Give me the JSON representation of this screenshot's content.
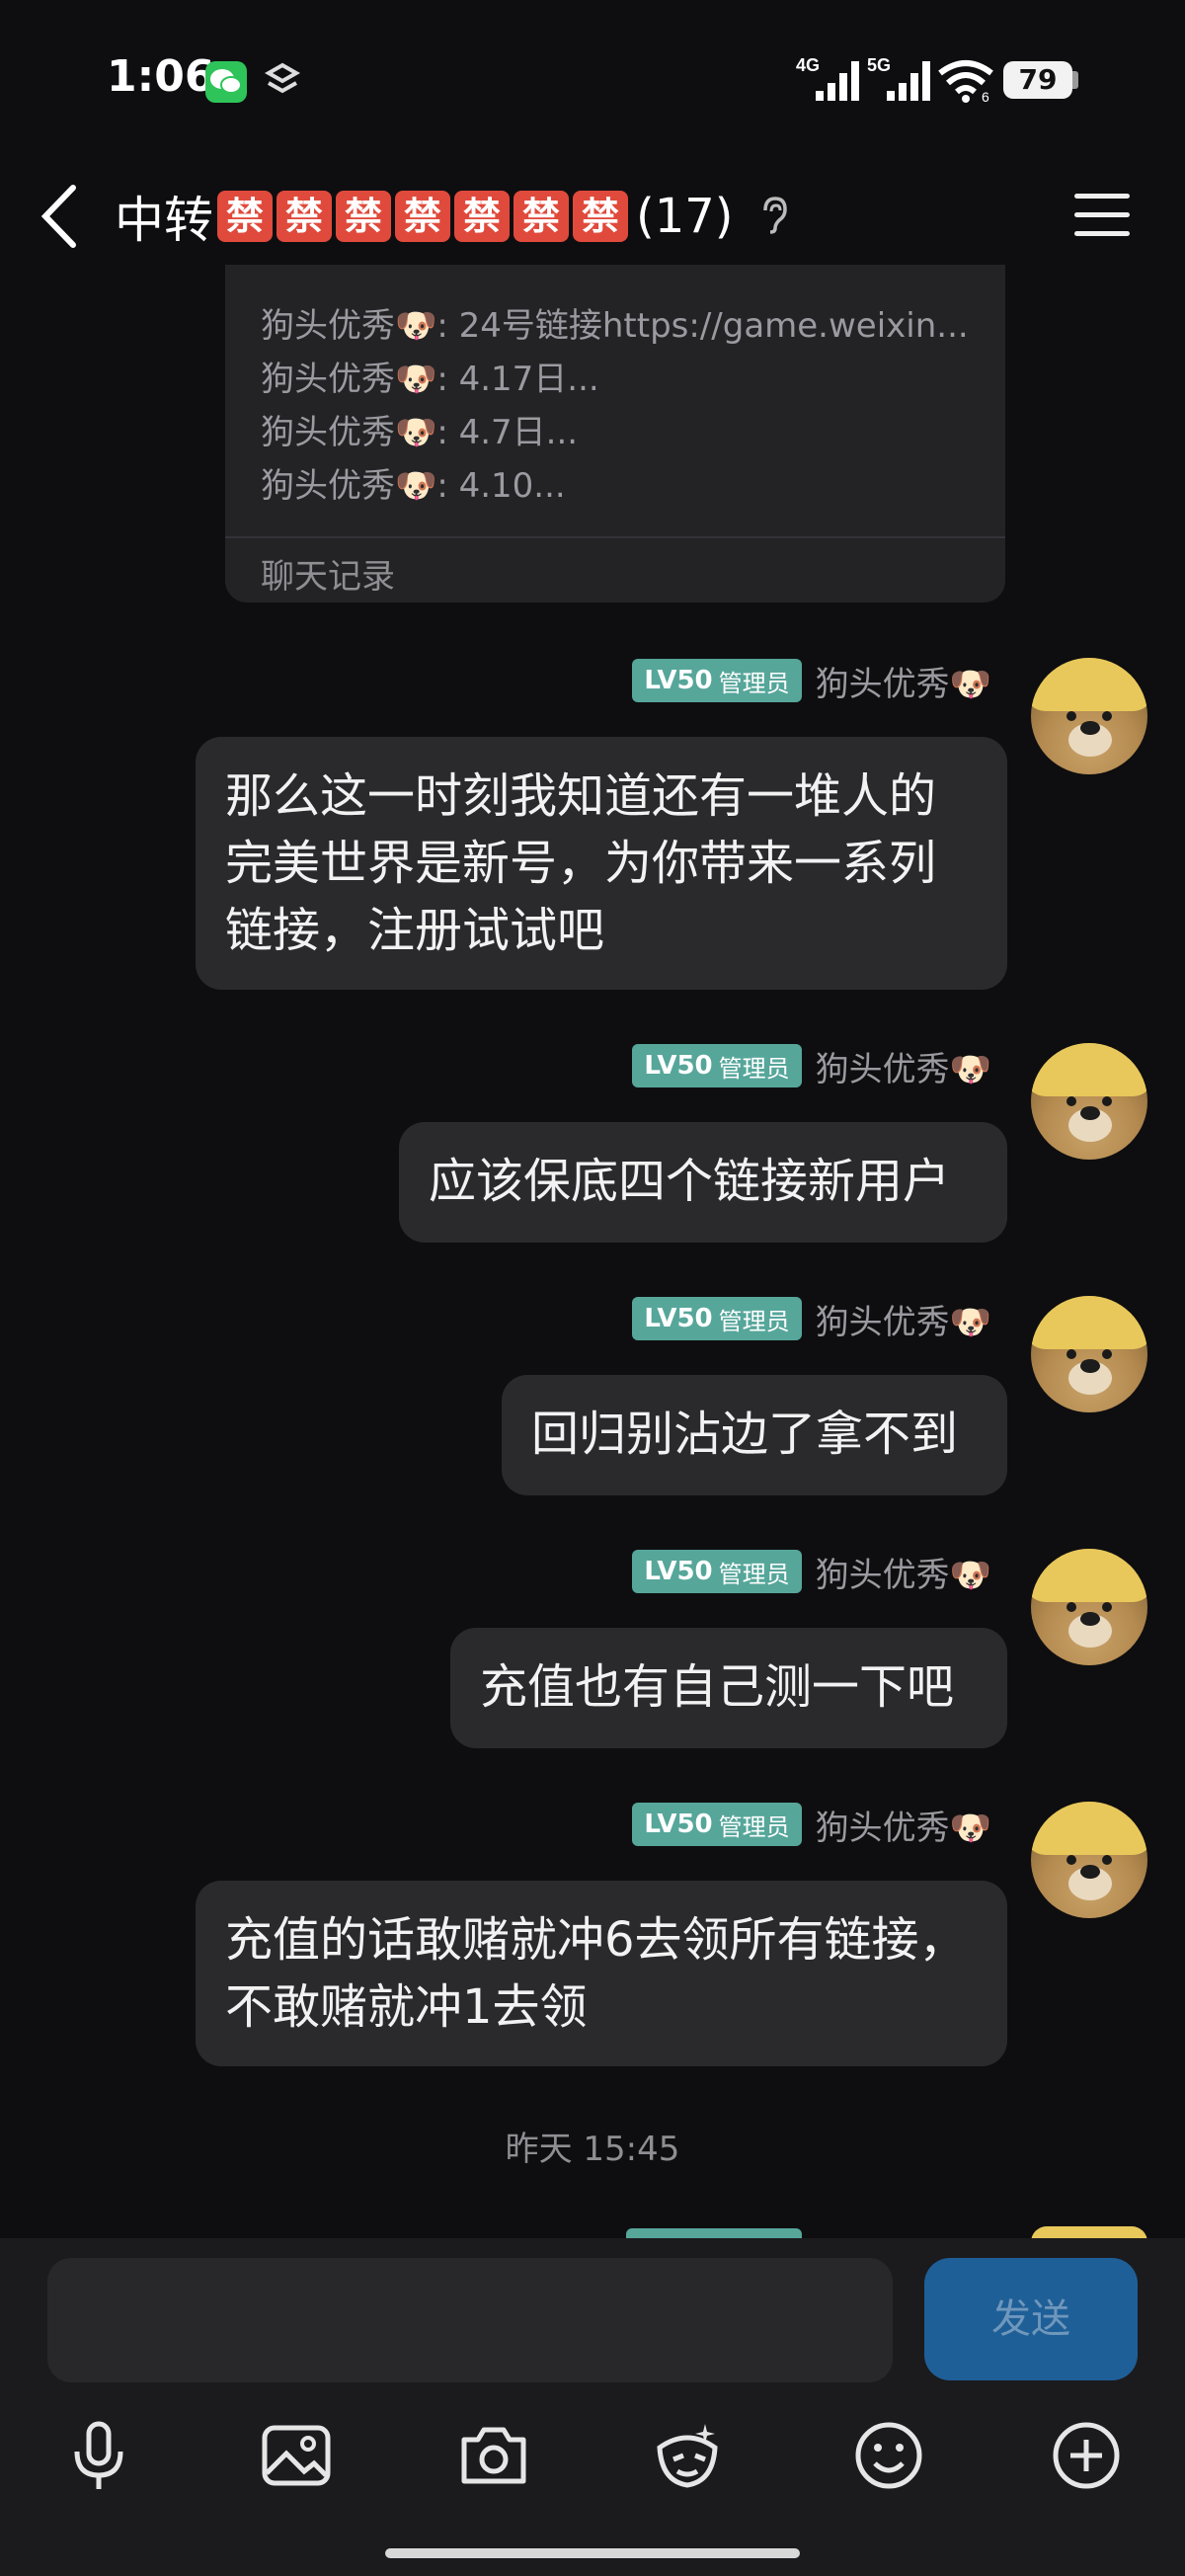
{
  "status_bar": {
    "time": "1:06",
    "network1": "4G",
    "network2": "5G",
    "wifi_label": "6",
    "battery": "79"
  },
  "header": {
    "title": "中转",
    "ban_glyph": "禁",
    "member_count": "(17)"
  },
  "record_card": {
    "lines": [
      "狗头优秀🐶: 24号链接https://game.weixin...",
      "狗头优秀🐶: 4.17日...",
      "狗头优秀🐶: 4.7日...",
      "狗头优秀🐶: 4.10..."
    ],
    "footer": "聊天记录"
  },
  "messages": [
    {
      "level": "LV50",
      "role": "管理员",
      "sender": "狗头优秀🐶",
      "text": "那么这一时刻我知道还有一堆人的完美世界是新号，为你带来一系列链接，注册试试吧"
    },
    {
      "level": "LV50",
      "role": "管理员",
      "sender": "狗头优秀🐶",
      "text": "应该保底四个链接新用户"
    },
    {
      "level": "LV50",
      "role": "管理员",
      "sender": "狗头优秀🐶",
      "text": "回归别沾边了拿不到"
    },
    {
      "level": "LV50",
      "role": "管理员",
      "sender": "狗头优秀🐶",
      "text": "充值也有自己测一下吧"
    },
    {
      "level": "LV50",
      "role": "管理员",
      "sender": "狗头优秀🐶",
      "text": "充值的话敢赌就冲6去领所有链接，不敢赌就冲1去领"
    }
  ],
  "timestamp": "昨天 15:45",
  "input": {
    "placeholder": "",
    "send_label": "发送"
  },
  "toolbar": [
    "microphone-icon",
    "image-icon",
    "camera-icon",
    "sticker-icon",
    "emoji-icon",
    "plus-icon"
  ],
  "colors": {
    "background": "#0e0e10",
    "bubble": "#2a2a2d",
    "badge": "#56a69a",
    "ban": "#e04a3c",
    "send": "#1f5f98"
  }
}
